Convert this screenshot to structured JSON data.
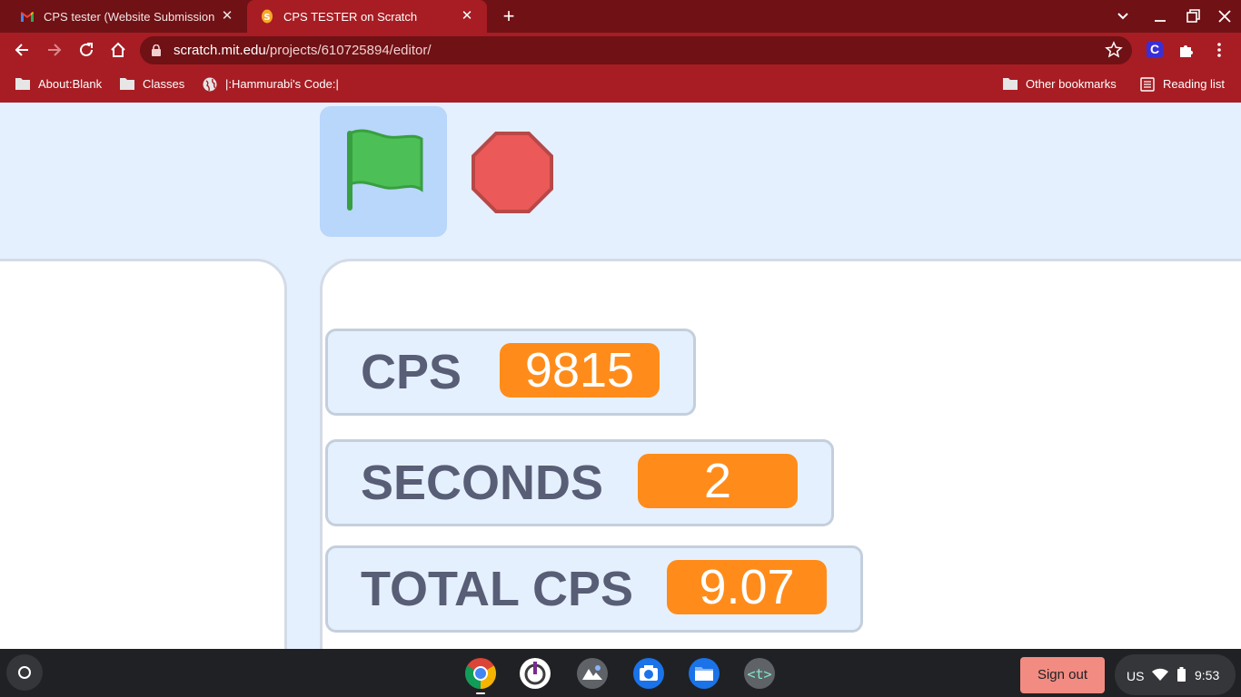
{
  "browser": {
    "tabs": [
      {
        "title": "CPS tester (Website Submission",
        "favicon": "gmail-icon",
        "active": false
      },
      {
        "title": "CPS TESTER on Scratch",
        "favicon": "scratch-icon",
        "active": true
      }
    ],
    "close_glyph": "✕",
    "new_tab_glyph": "+",
    "address": {
      "host": "scratch.mit.edu",
      "path": "/projects/610725894/editor/"
    },
    "extension_letter": "C",
    "bookmarks": [
      {
        "label": "About:Blank",
        "icon": "folder-icon"
      },
      {
        "label": "Classes",
        "icon": "folder-icon"
      },
      {
        "label": "|:Hammurabi's Code:|",
        "icon": "globe-icon"
      }
    ],
    "other_bookmarks": "Other bookmarks",
    "reading_list": "Reading list"
  },
  "scratch": {
    "green_flag": "green-flag-icon",
    "stop": "stop-sign-icon",
    "monitors": [
      {
        "label": "CPS",
        "value": "9815"
      },
      {
        "label": "SECONDS",
        "value": "2"
      },
      {
        "label": "TOTAL CPS",
        "value": "9.07"
      }
    ]
  },
  "shelf": {
    "apps": [
      "chrome-icon",
      "power-app-icon",
      "gallery-icon",
      "camera-icon",
      "files-icon",
      "text-editor-icon"
    ],
    "sign_out": "Sign out",
    "ime": "US",
    "time": "9:53"
  },
  "colors": {
    "tabstrip": "#6f1115",
    "toolbar": "#a71d23",
    "monitor_value": "#ff8c1a",
    "monitor_label": "#575e75",
    "stage_bg": "#e5f0ff",
    "sign_out": "#f28b82"
  }
}
